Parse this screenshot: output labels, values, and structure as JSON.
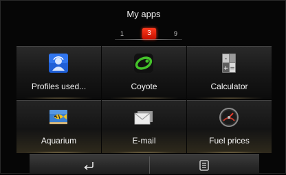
{
  "header": {
    "title": "My apps"
  },
  "pager": {
    "first": "1",
    "current": "3",
    "last": "9"
  },
  "apps": [
    {
      "label": "Profiles used...",
      "icon": "profiles-icon"
    },
    {
      "label": "Coyote",
      "icon": "coyote-icon"
    },
    {
      "label": "Calculator",
      "icon": "calculator-icon"
    },
    {
      "label": "Aquarium",
      "icon": "aquarium-icon"
    },
    {
      "label": "E-mail",
      "icon": "email-icon"
    },
    {
      "label": "Fuel prices",
      "icon": "fuel-gauge-icon"
    }
  ],
  "bottom_bar": {
    "back": "back-arrow-icon",
    "menu": "menu-list-icon"
  },
  "colors": {
    "accent": "#e82a10",
    "tile_text": "#f4f4f4"
  }
}
